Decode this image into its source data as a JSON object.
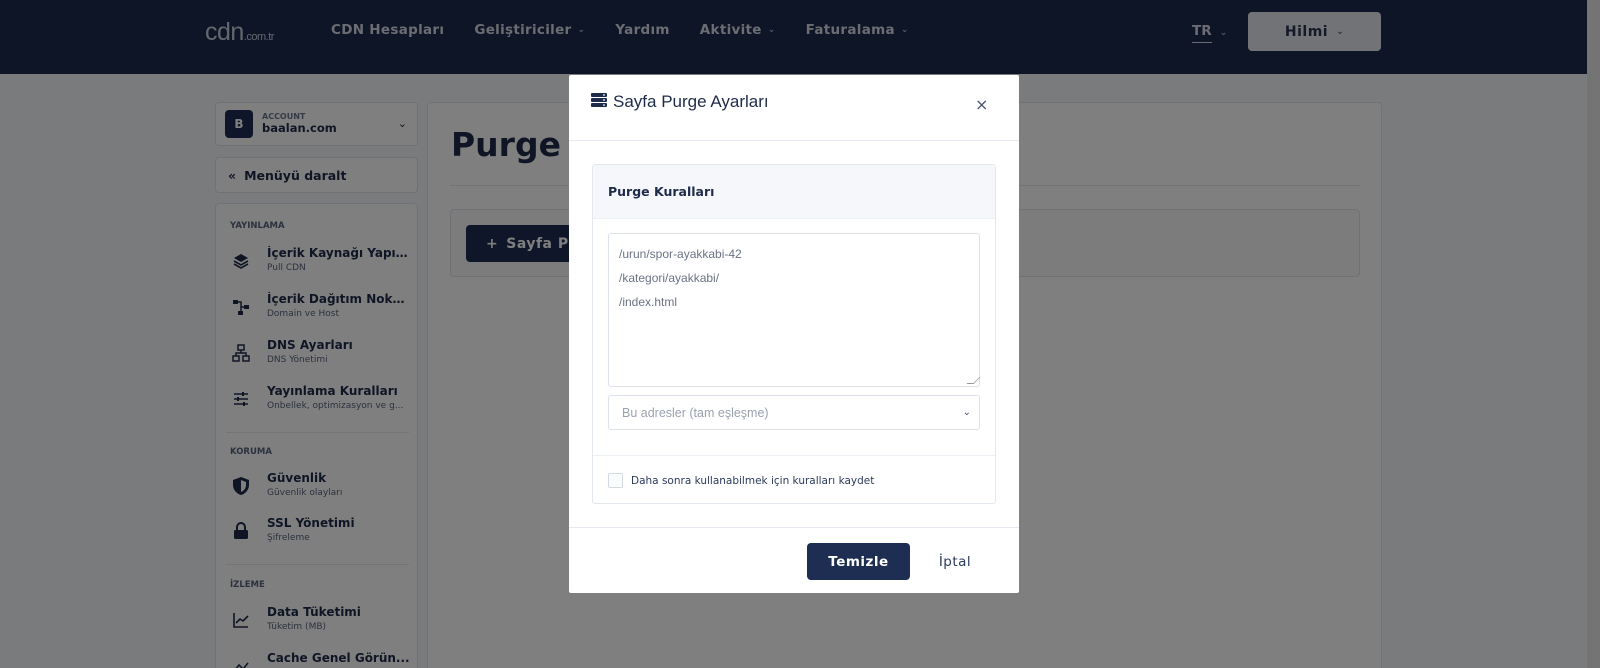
{
  "header": {
    "logo_main": "cdn",
    "logo_suffix": ".com.tr",
    "nav": [
      {
        "label": "CDN Hesapları",
        "has_dropdown": false
      },
      {
        "label": "Geliştiriciler",
        "has_dropdown": true
      },
      {
        "label": "Yardım",
        "has_dropdown": false
      },
      {
        "label": "Aktivite",
        "has_dropdown": true
      },
      {
        "label": "Faturalama",
        "has_dropdown": true
      }
    ],
    "language": "TR",
    "user": "Hilmi"
  },
  "sidebar": {
    "account_label": "ACCOUNT",
    "account_initial": "B",
    "account_name": "baalan.com",
    "collapse_label": "Menüyü daralt",
    "sections": [
      {
        "title": "YAYINLAMA",
        "items": [
          {
            "title": "İçerik Kaynağı Yapıl...",
            "subtitle": "Pull CDN",
            "icon": "layers-icon"
          },
          {
            "title": "İçerik Dağıtım Nokt...",
            "subtitle": "Domain ve Host",
            "icon": "flow-icon"
          },
          {
            "title": "DNS Ayarları",
            "subtitle": "DNS Yönetimi",
            "icon": "network-icon"
          },
          {
            "title": "Yayınlama Kuralları",
            "subtitle": "Önbellek, optimizasyon ve g...",
            "icon": "sliders-icon"
          }
        ]
      },
      {
        "title": "KORUMA",
        "items": [
          {
            "title": "Güvenlik",
            "subtitle": "Güvenlik olayları",
            "icon": "shield-icon"
          },
          {
            "title": "SSL Yönetimi",
            "subtitle": "Şifreleme",
            "icon": "lock-icon"
          }
        ]
      },
      {
        "title": "İZLEME",
        "items": [
          {
            "title": "Data Tüketimi",
            "subtitle": "Tüketim (MB)",
            "icon": "chart-line-icon"
          },
          {
            "title": "Cache Genel Görün...",
            "subtitle": "",
            "icon": "chart-icon"
          }
        ]
      }
    ]
  },
  "main": {
    "page_title_visible": "Purge a",
    "add_button_visible": "Sayfa P"
  },
  "modal": {
    "title": "Sayfa Purge Ayarları",
    "close": "×",
    "card_title": "Purge Kuralları",
    "rules_text": "/urun/spor-ayakkabi-42\n/kategori/ayakkabi/\n/index.html",
    "match_select": "Bu adresler (tam eşleşme)",
    "save_rules_label": "Daha sonra kullanabilmek için kuralları kaydet",
    "submit": "Temizle",
    "cancel": "İptal"
  },
  "colors": {
    "navy": "#1e2d52",
    "topbar": "#1b2b4f",
    "overlay": "rgba(0,0,0,0.5)"
  }
}
